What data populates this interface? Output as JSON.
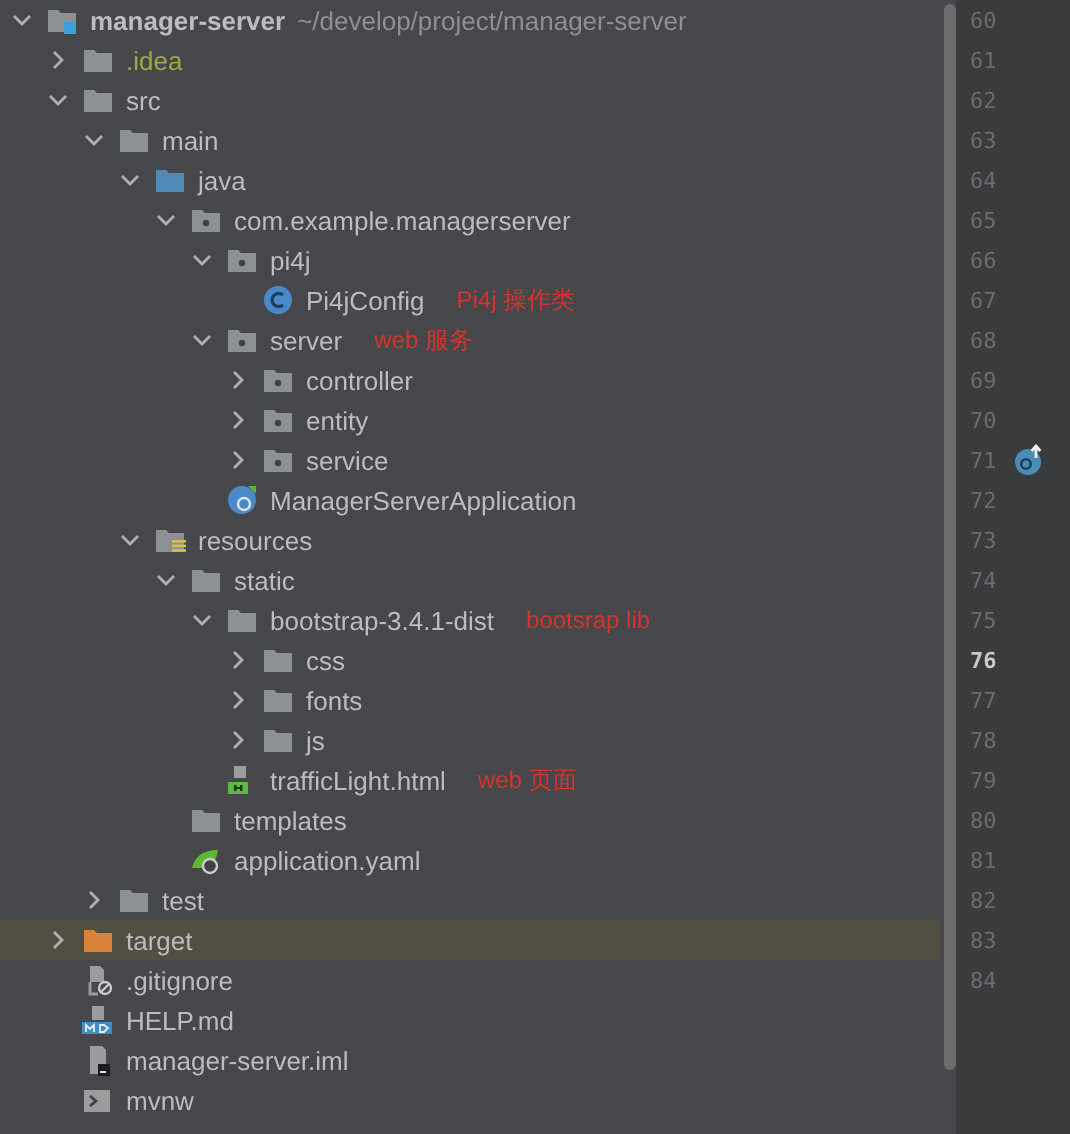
{
  "project_tree": {
    "nodes": [
      {
        "kind": "module",
        "label": "manager-server",
        "path": "~/develop/project/manager-server",
        "expanded": true,
        "selected": false,
        "children": [
          {
            "kind": "ignored-folder",
            "label": ".idea",
            "expanded": false,
            "selected": false
          },
          {
            "kind": "folder",
            "label": "src",
            "expanded": true,
            "selected": false,
            "children": [
              {
                "kind": "folder",
                "label": "main",
                "expanded": true,
                "selected": false,
                "children": [
                  {
                    "kind": "source-folder",
                    "label": "java",
                    "expanded": true,
                    "selected": false,
                    "children": [
                      {
                        "kind": "package",
                        "label": "com.example.managerserver",
                        "expanded": true,
                        "selected": false,
                        "children": [
                          {
                            "kind": "package",
                            "label": "pi4j",
                            "expanded": true,
                            "selected": false,
                            "children": [
                              {
                                "kind": "class",
                                "label": "Pi4jConfig",
                                "note": "Pi4j 操作类",
                                "selected": false
                              }
                            ]
                          },
                          {
                            "kind": "package",
                            "label": "server",
                            "note": "web 服务",
                            "expanded": true,
                            "selected": false,
                            "children": [
                              {
                                "kind": "package",
                                "label": "controller",
                                "expanded": false,
                                "selected": false
                              },
                              {
                                "kind": "package",
                                "label": "entity",
                                "expanded": false,
                                "selected": false
                              },
                              {
                                "kind": "package",
                                "label": "service",
                                "expanded": false,
                                "selected": false
                              }
                            ]
                          },
                          {
                            "kind": "spring-app",
                            "label": "ManagerServerApplication",
                            "selected": false
                          }
                        ]
                      }
                    ]
                  },
                  {
                    "kind": "resources-folder",
                    "label": "resources",
                    "expanded": true,
                    "selected": false,
                    "children": [
                      {
                        "kind": "folder",
                        "label": "static",
                        "expanded": true,
                        "selected": false,
                        "children": [
                          {
                            "kind": "folder",
                            "label": "bootstrap-3.4.1-dist",
                            "note": "bootsrap lib",
                            "expanded": true,
                            "selected": false,
                            "children": [
                              {
                                "kind": "folder",
                                "label": "css",
                                "expanded": false,
                                "selected": false
                              },
                              {
                                "kind": "folder",
                                "label": "fonts",
                                "expanded": false,
                                "selected": false
                              },
                              {
                                "kind": "folder",
                                "label": "js",
                                "expanded": false,
                                "selected": false
                              }
                            ]
                          },
                          {
                            "kind": "html",
                            "label": "trafficLight.html",
                            "note": "web 页面",
                            "selected": false
                          }
                        ]
                      },
                      {
                        "kind": "folder",
                        "label": "templates",
                        "selected": false
                      },
                      {
                        "kind": "yaml",
                        "label": "application.yaml",
                        "selected": false
                      }
                    ]
                  }
                ]
              },
              {
                "kind": "folder",
                "label": "test",
                "expanded": false,
                "selected": false
              }
            ]
          },
          {
            "kind": "excluded-folder",
            "label": "target",
            "expanded": false,
            "selected": true
          },
          {
            "kind": "gitignore",
            "label": ".gitignore",
            "selected": false
          },
          {
            "kind": "markdown",
            "label": "HELP.md",
            "selected": false
          },
          {
            "kind": "iml",
            "label": "manager-server.iml",
            "selected": false
          },
          {
            "kind": "script",
            "label": "mvnw",
            "selected": false
          }
        ]
      }
    ]
  },
  "gutter": {
    "lines": [
      {
        "number": "60",
        "current": false,
        "marker": false
      },
      {
        "number": "61",
        "current": false,
        "marker": false
      },
      {
        "number": "62",
        "current": false,
        "marker": false
      },
      {
        "number": "63",
        "current": false,
        "marker": false
      },
      {
        "number": "64",
        "current": false,
        "marker": false
      },
      {
        "number": "65",
        "current": false,
        "marker": false
      },
      {
        "number": "66",
        "current": false,
        "marker": false
      },
      {
        "number": "67",
        "current": false,
        "marker": false
      },
      {
        "number": "68",
        "current": false,
        "marker": false
      },
      {
        "number": "69",
        "current": false,
        "marker": false
      },
      {
        "number": "70",
        "current": false,
        "marker": false
      },
      {
        "number": "71",
        "current": false,
        "marker": true
      },
      {
        "number": "72",
        "current": false,
        "marker": false
      },
      {
        "number": "73",
        "current": false,
        "marker": false
      },
      {
        "number": "74",
        "current": false,
        "marker": false
      },
      {
        "number": "75",
        "current": false,
        "marker": false
      },
      {
        "number": "76",
        "current": true,
        "marker": false
      },
      {
        "number": "77",
        "current": false,
        "marker": false
      },
      {
        "number": "78",
        "current": false,
        "marker": false
      },
      {
        "number": "79",
        "current": false,
        "marker": false
      },
      {
        "number": "80",
        "current": false,
        "marker": false
      },
      {
        "number": "81",
        "current": false,
        "marker": false
      },
      {
        "number": "82",
        "current": false,
        "marker": false
      },
      {
        "number": "83",
        "current": false,
        "marker": false
      },
      {
        "number": "84",
        "current": false,
        "marker": false
      }
    ]
  }
}
